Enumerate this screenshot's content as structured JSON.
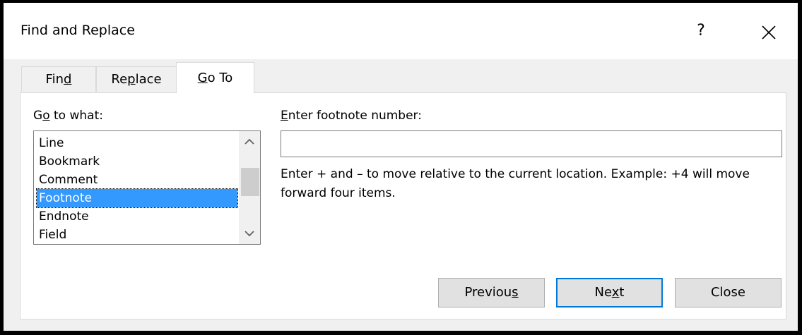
{
  "window": {
    "title": "Find and Replace",
    "help_label": "?",
    "close_icon": "close-icon"
  },
  "tabs": [
    {
      "pre": "Fin",
      "key": "d",
      "post": "",
      "active": false
    },
    {
      "pre": "Re",
      "key": "p",
      "post": "lace",
      "active": false
    },
    {
      "pre": "",
      "key": "G",
      "post": "o To",
      "active": true
    }
  ],
  "goto_what": {
    "label_pre": "G",
    "label_key": "o",
    "label_post": " to what:",
    "items": [
      "Line",
      "Bookmark",
      "Comment",
      "Footnote",
      "Endnote",
      "Field"
    ],
    "selected": "Footnote",
    "scroll_up_icon": "chevron-up-icon",
    "scroll_down_icon": "chevron-down-icon"
  },
  "entry": {
    "label_key": "E",
    "label_post": "nter footnote number:",
    "value": "",
    "hint": "Enter + and – to move relative to the current location. Example: +4 will move forward four items."
  },
  "buttons": {
    "previous": {
      "pre": "Previou",
      "key": "s",
      "post": ""
    },
    "next": {
      "pre": "Ne",
      "key": "x",
      "post": "t"
    },
    "close": "Close"
  },
  "colors": {
    "selection": "#3399ff",
    "default_button_border": "#0078d7",
    "background": "#f0f0f0"
  }
}
